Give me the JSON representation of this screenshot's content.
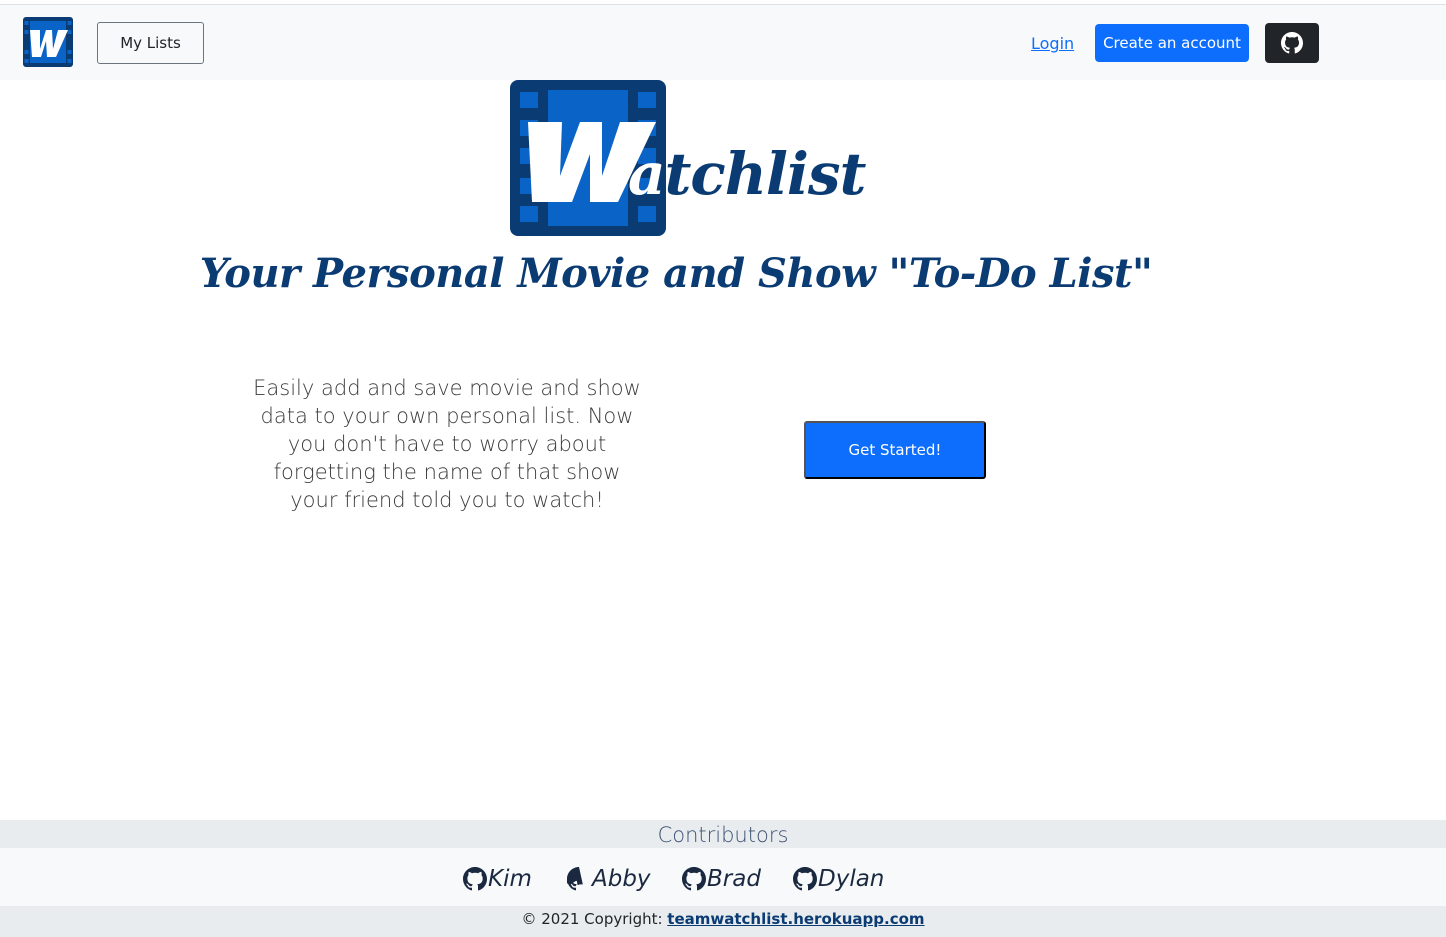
{
  "navbar": {
    "my_lists_label": "My Lists",
    "login_label": "Login",
    "create_account_label": "Create an account"
  },
  "hero": {
    "logo_text_rest": "tchlist",
    "logo_letter_a": "a",
    "tagline": "Your Personal Movie and Show \"To-Do List\"",
    "intro_text": "Easily add and save movie and show data to your own personal list. Now you don't have to worry about forgetting the name of that show your friend told you to watch!",
    "get_started_label": "Get Started!"
  },
  "footer": {
    "contributors_heading": "Contributors",
    "contributors": [
      "Kim",
      "Abby",
      "Brad",
      "Dylan"
    ],
    "copyright_prefix": "© 2021 Copyright: ",
    "copyright_link": "teamwatchlist.herokuapp.com"
  },
  "colors": {
    "primary": "#0d6efd",
    "brand_dark_blue": "#0b3b73",
    "dark": "#212529",
    "navbar_bg": "#f8f9fa",
    "footer_bg": "#e9ecef"
  },
  "icons": {
    "nav_logo": "watchlist-w-logo-icon",
    "github": "github-icon",
    "hero_logo": "film-strip-w-logo-icon"
  }
}
